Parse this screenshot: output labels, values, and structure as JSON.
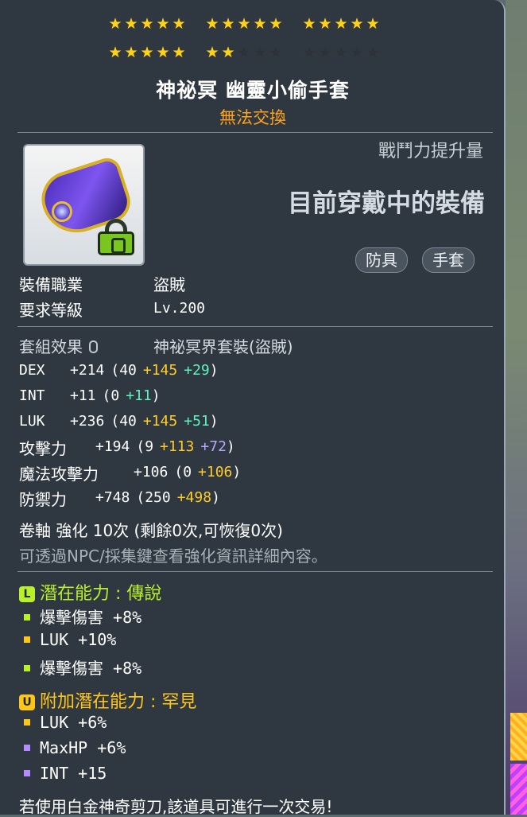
{
  "stars": {
    "row1": [
      5,
      5,
      5
    ],
    "row2_filled": [
      5,
      2,
      0
    ],
    "per_group": 5
  },
  "item": {
    "name": "神祕冥 幽靈小偷手套",
    "trade": "無法交換",
    "cp_label": "戰鬥力提升量",
    "current_equipped": "目前穿戴中的裝備",
    "tags": [
      "防具",
      "手套"
    ],
    "icon": "purple-glove-icon",
    "lock_icon": "green-lock-icon"
  },
  "requirements": {
    "job_label": "裝備職業",
    "job_value": "盜賊",
    "level_label": "要求等級",
    "level_value": "Lv.200"
  },
  "set": {
    "label": "套組效果",
    "value": "神祕冥界套裝(盜賊)"
  },
  "stats": [
    {
      "name": "DEX",
      "total": "+214",
      "base": "(40",
      "flame": "+145",
      "star": "+29",
      "close": ")",
      "star_color": "cyan"
    },
    {
      "name": "INT",
      "total": "+11",
      "base": "(0",
      "flame": "",
      "star": "+11",
      "close": ")",
      "star_color": "cyan"
    },
    {
      "name": "LUK",
      "total": "+236",
      "base": "(40",
      "flame": "+145",
      "star": "+51",
      "close": ")",
      "star_color": "cyan"
    },
    {
      "name": "攻擊力",
      "total": "+194",
      "base": "(9",
      "flame": "+113",
      "star": "+72",
      "close": ")",
      "star_color": "purple"
    },
    {
      "name": "魔法攻擊力",
      "total": "+106",
      "base": "(0",
      "flame": "+106",
      "star": "",
      "close": ")",
      "star_color": "yellow"
    },
    {
      "name": "防禦力",
      "total": "+748",
      "base": "(250",
      "flame": "+498",
      "star": "",
      "close": ")",
      "star_color": "yellow"
    }
  ],
  "scroll": {
    "text": "卷軸 強化 10次 (剩餘0次,可恢復0次)",
    "hint": "可透過NPC/採集鍵查看強化資訊詳細內容。"
  },
  "potential": {
    "label": "潛在能力",
    "sep": " : ",
    "grade": "傳說",
    "badge": "L",
    "lines": [
      {
        "text": "爆擊傷害 +8%",
        "color": "green"
      },
      {
        "text": "LUK +10%",
        "color": "yellow"
      },
      {
        "text": "爆擊傷害 +8%",
        "color": "green"
      }
    ]
  },
  "additional": {
    "label": "附加潛在能力",
    "sep": " : ",
    "grade": "罕見",
    "badge": "U",
    "lines": [
      {
        "text": "LUK +6%",
        "color": "yellow"
      },
      {
        "text": "MaxHP +6%",
        "color": "purple"
      },
      {
        "text": "INT +15",
        "color": "purple"
      }
    ]
  },
  "footer": "若使用白金神奇剪刀,該道具可進行一次交易!",
  "colors": {
    "star_on": "#ffd21a",
    "trade": "#ffa21e",
    "flame": "#ffcc2a",
    "star_force": "#5ef2c0",
    "potential_green": "#b8f02a",
    "potential_yellow": "#ffc61a"
  }
}
